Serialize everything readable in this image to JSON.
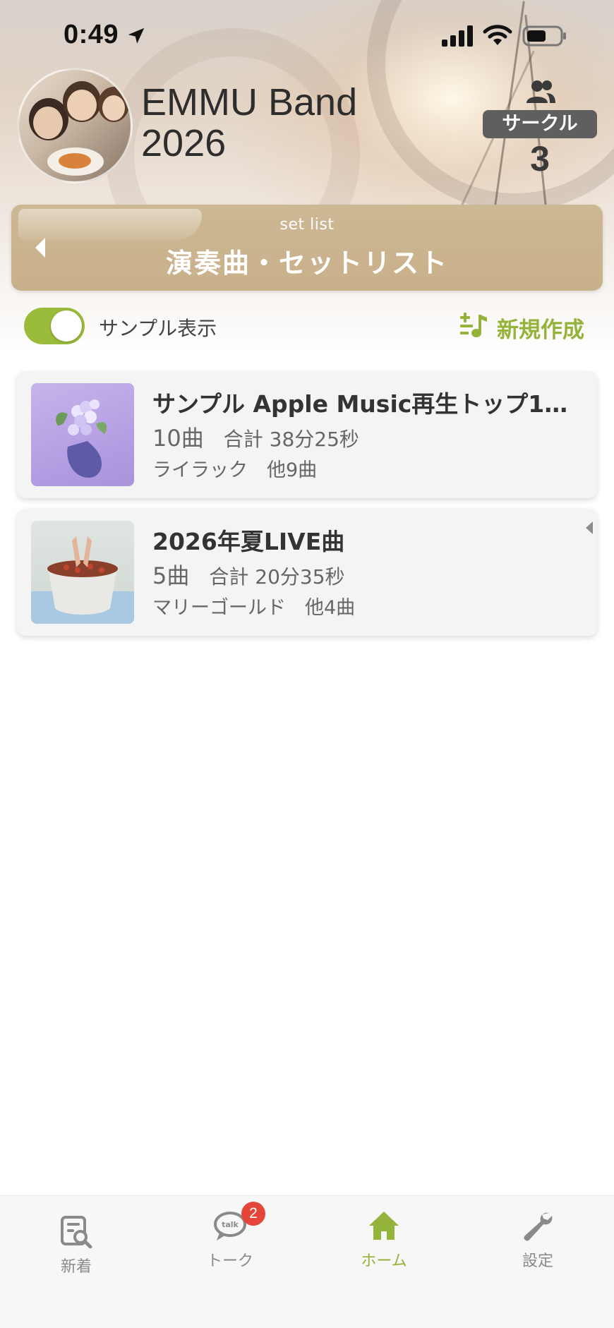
{
  "status_bar": {
    "time": "0:49",
    "icons": [
      "location-arrow-icon",
      "cellular-signal-icon",
      "wifi-icon",
      "battery-icon"
    ]
  },
  "header": {
    "band_name": "EMMU Band\n2026",
    "circle_label": "サークル",
    "member_count": "3"
  },
  "setlist_banner": {
    "subtitle": "set list",
    "title": "演奏曲・セットリスト"
  },
  "controls": {
    "sample_toggle_label": "サンプル表示",
    "sample_toggle_on": true,
    "new_button_label": "新規作成"
  },
  "setlists": [
    {
      "title": "サンプル Apple Music再生トップ1…",
      "count": "10曲",
      "total": "合計 38分25秒",
      "songs": "ライラック　他9曲"
    },
    {
      "title": "2026年夏LIVE曲",
      "count": "5曲",
      "total": "合計 20分35秒",
      "songs": "マリーゴールド　他4曲"
    }
  ],
  "tabbar": {
    "tabs": [
      {
        "label": "新着",
        "icon": "news-search-icon"
      },
      {
        "label": "トーク",
        "icon": "talk-bubble-icon",
        "badge": "2"
      },
      {
        "label": "ホーム",
        "icon": "home-icon",
        "active": true
      },
      {
        "label": "設定",
        "icon": "wrench-icon"
      }
    ]
  },
  "colors": {
    "accent_green": "#94b33a",
    "banner_gold": "#c8b08a",
    "badge_red": "#e5463a"
  }
}
